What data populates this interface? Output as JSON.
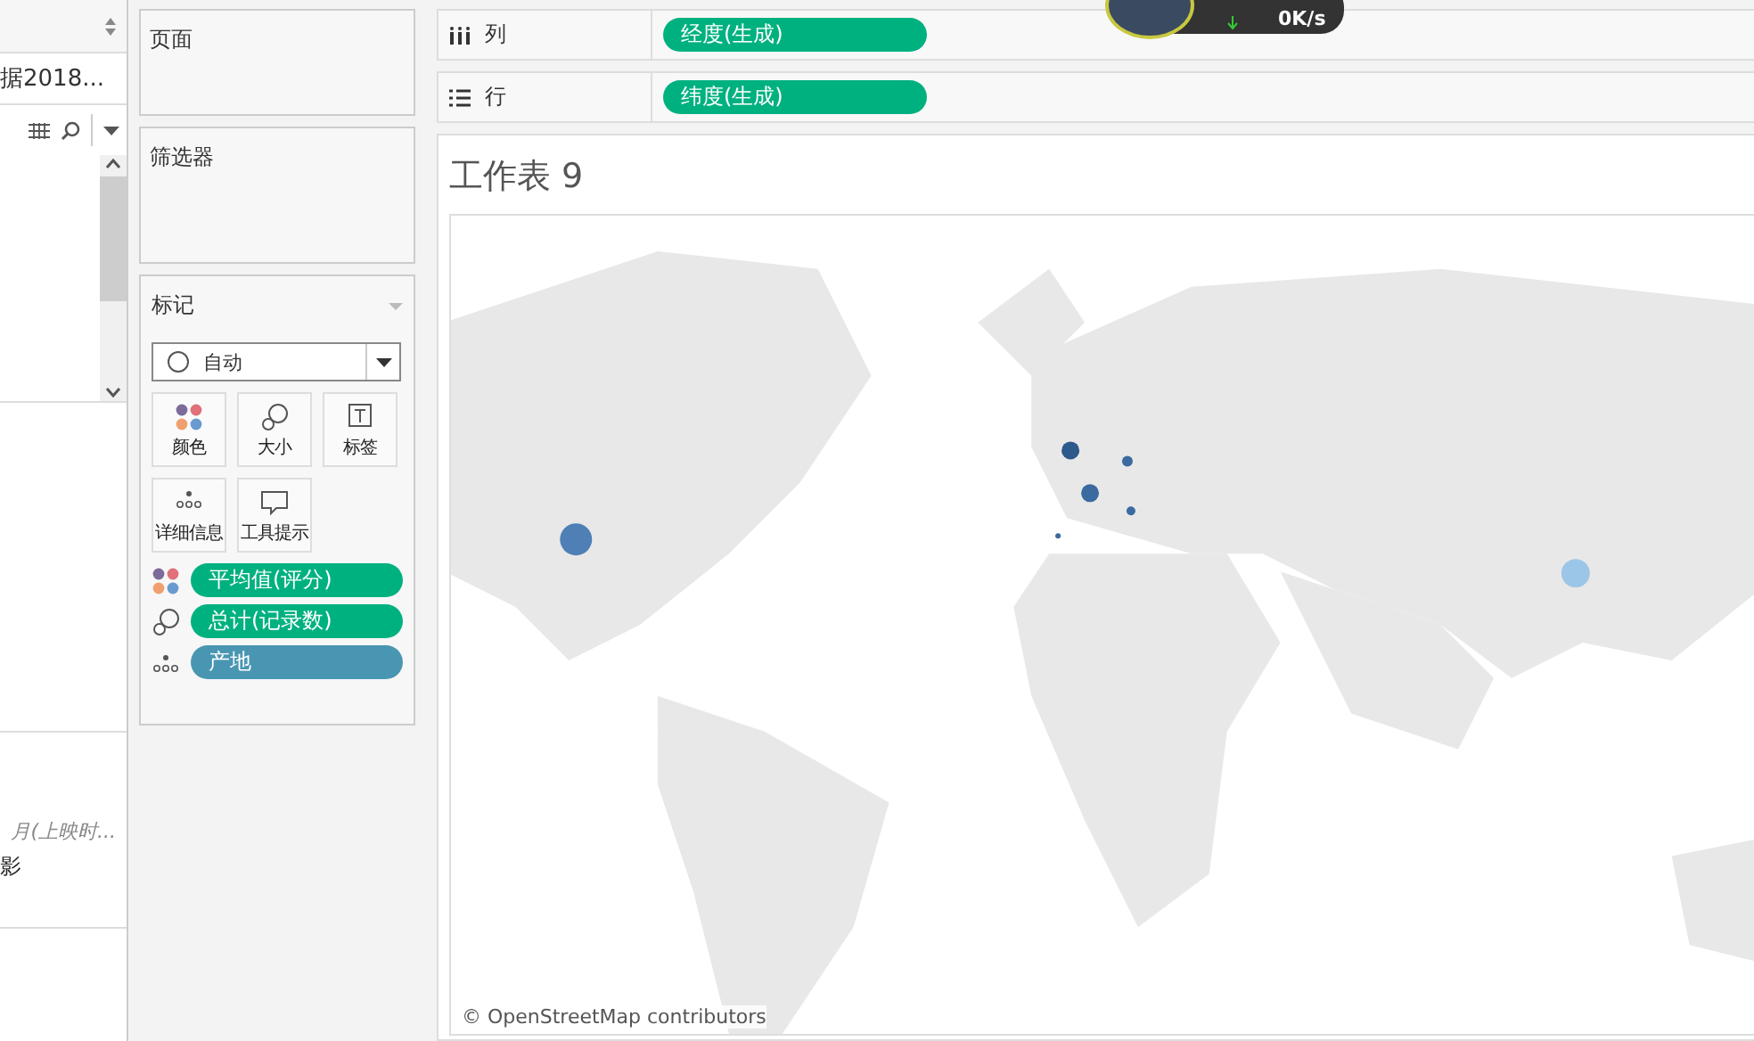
{
  "data_pane": {
    "source": "据2018...",
    "field_caption": "月(上映时...",
    "field_name": "影"
  },
  "shelves": {
    "pages": {
      "title": "页面"
    },
    "filters": {
      "title": "筛选器"
    },
    "columns": {
      "label": "列",
      "pill": "经度(生成)"
    },
    "rows": {
      "label": "行",
      "pill": "纬度(生成)"
    }
  },
  "marks": {
    "title": "标记",
    "mark_type": "自动",
    "cards": [
      {
        "kind": "color",
        "label": "颜色"
      },
      {
        "kind": "size",
        "label": "大小"
      },
      {
        "kind": "label",
        "label": "标签"
      },
      {
        "kind": "detail",
        "label": "详细信息"
      },
      {
        "kind": "tooltip",
        "label": "工具提示"
      }
    ],
    "encodings": [
      {
        "kind": "color",
        "field": "平均值(评分)",
        "color": "#00b180"
      },
      {
        "kind": "size",
        "field": "总计(记录数)",
        "color": "#00b180"
      },
      {
        "kind": "detail",
        "field": "产地",
        "color": "#4996b2"
      }
    ]
  },
  "sheet": {
    "title": "工作表 9",
    "attribution": "© OpenStreetMap contributors"
  },
  "speed_widget": {
    "reading": "0K/s"
  }
}
